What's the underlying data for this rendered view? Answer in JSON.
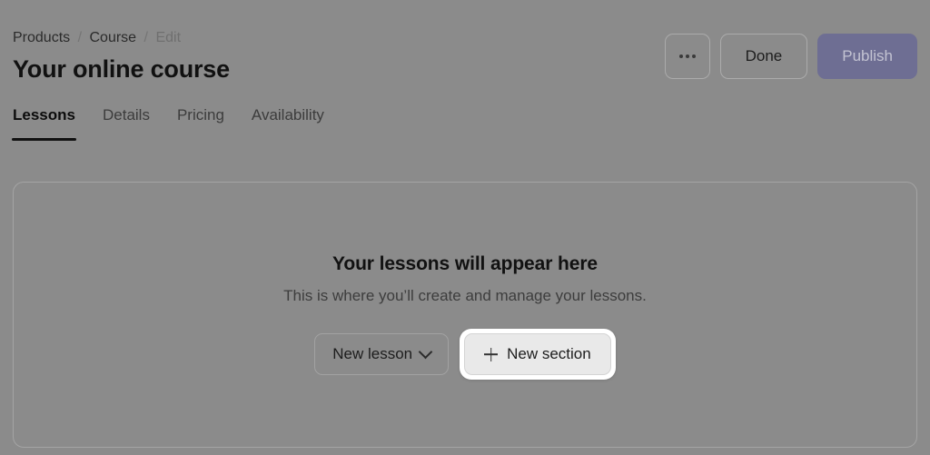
{
  "breadcrumb": {
    "items": [
      {
        "label": "Products",
        "current": false
      },
      {
        "label": "Course",
        "current": false
      },
      {
        "label": "Edit",
        "current": true
      }
    ],
    "separator": "/"
  },
  "header": {
    "title": "Your online course",
    "actions": {
      "more_label": "",
      "more_icon": "ellipsis-icon",
      "done_label": "Done",
      "publish_label": "Publish",
      "publish_color": "#6e6e93"
    }
  },
  "tabs": [
    {
      "label": "Lessons",
      "active": true
    },
    {
      "label": "Details",
      "active": false
    },
    {
      "label": "Pricing",
      "active": false
    },
    {
      "label": "Availability",
      "active": false
    }
  ],
  "empty_state": {
    "title": "Your lessons will appear here",
    "subtitle": "This is where you’ll create and manage your lessons.",
    "new_lesson_label": "New lesson",
    "new_lesson_icon": "chevron-down-icon",
    "new_section_label": "New section",
    "new_section_icon": "plus-icon"
  },
  "theme": {
    "overlay": "#8b8b8b",
    "text_primary": "#111111",
    "text_muted": "#6f6f6f",
    "focus_ring": "#ffffff"
  }
}
